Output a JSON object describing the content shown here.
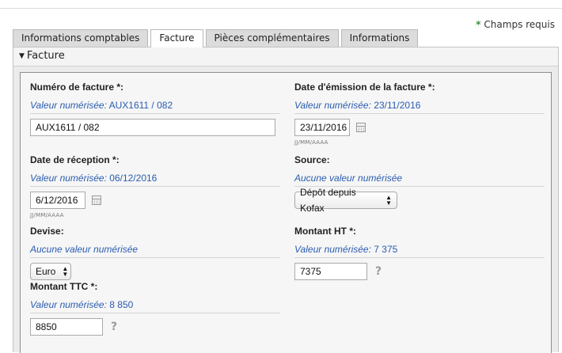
{
  "required_note": {
    "star": "*",
    "text": "Champs requis"
  },
  "tabs": [
    {
      "label": "Informations comptables"
    },
    {
      "label": "Facture"
    },
    {
      "label": "Pièces complémentaires"
    },
    {
      "label": "Informations"
    }
  ],
  "panel": {
    "title": "Facture"
  },
  "fields": {
    "invoice_number": {
      "label": "Numéro de facture *:",
      "scanned_prefix": "Valeur numérisée:",
      "scanned_value": "AUX1611 / 082",
      "value": "AUX1611 / 082"
    },
    "issue_date": {
      "label": "Date d'émission de la facture *:",
      "scanned_prefix": "Valeur numérisée:",
      "scanned_value": "23/11/2016",
      "value": "23/11/2016",
      "hint": "JJ/MM/AAAA"
    },
    "reception_date": {
      "label": "Date de réception *:",
      "scanned_prefix": "Valeur numérisée:",
      "scanned_value": "06/12/2016",
      "value": "6/12/2016",
      "hint": "JJ/MM/AAAA"
    },
    "source": {
      "label": "Source:",
      "scanned_text": "Aucune valeur numérisée",
      "selected": "Dépôt depuis Kofax"
    },
    "currency": {
      "label": "Devise:",
      "scanned_text": "Aucune valeur numérisée",
      "selected": "Euro"
    },
    "amount_ht": {
      "label": "Montant HT *:",
      "scanned_prefix": "Valeur numérisée:",
      "scanned_value": "7 375",
      "value": "7375",
      "help": "?"
    },
    "amount_ttc": {
      "label": "Montant TTC *:",
      "scanned_prefix": "Valeur numérisée:",
      "scanned_value": "8 850",
      "value": "8850",
      "help": "?"
    }
  }
}
